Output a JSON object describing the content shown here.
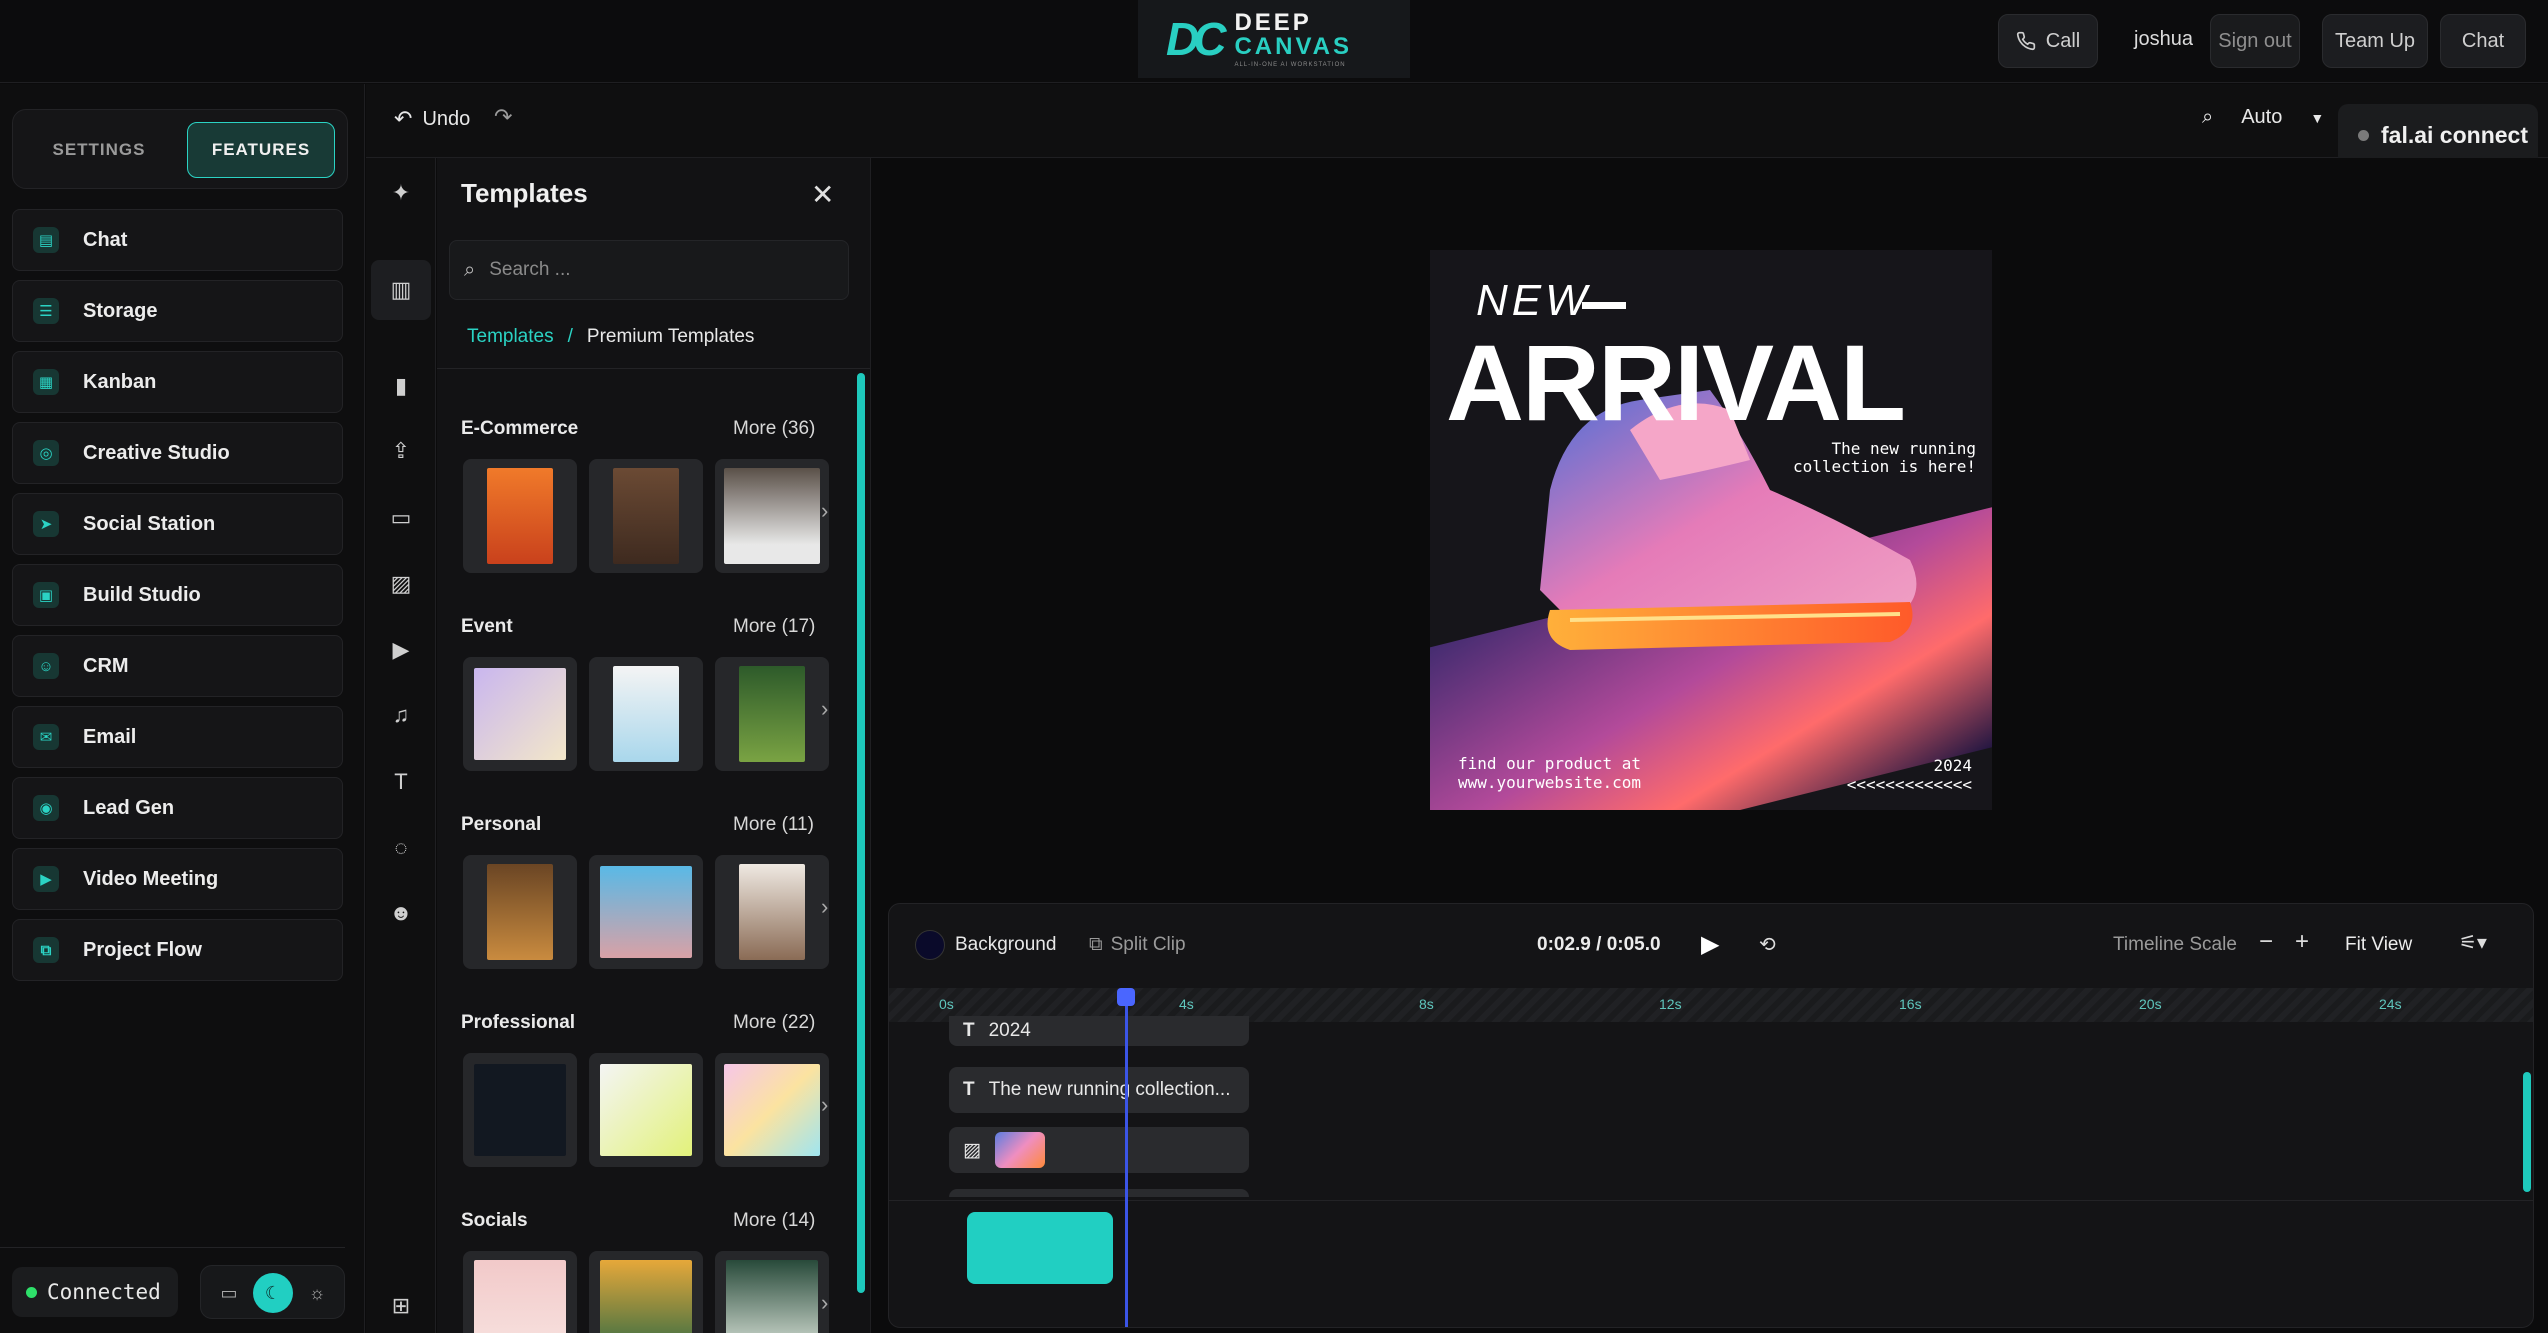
{
  "header": {
    "logo_mark": "DC",
    "logo_line1": "DEEP",
    "logo_line2": "CANVAS",
    "logo_tagline": "ALL-IN-ONE AI WORKSTATION",
    "call_label": "Call",
    "user_name": "joshua",
    "sign_out_label": "Sign out",
    "team_up_label": "Team Up",
    "chat_label": "Chat"
  },
  "sidebar": {
    "settings_tab": "SETTINGS",
    "features_tab": "FEATURES",
    "items": [
      {
        "label": "Chat",
        "icon": "chat-icon"
      },
      {
        "label": "Storage",
        "icon": "storage-icon"
      },
      {
        "label": "Kanban",
        "icon": "kanban-icon"
      },
      {
        "label": "Creative Studio",
        "icon": "palette-icon"
      },
      {
        "label": "Social Station",
        "icon": "send-icon"
      },
      {
        "label": "Build Studio",
        "icon": "grid-icon"
      },
      {
        "label": "CRM",
        "icon": "users-icon"
      },
      {
        "label": "Email",
        "icon": "mail-icon"
      },
      {
        "label": "Lead Gen",
        "icon": "target-icon"
      },
      {
        "label": "Video Meeting",
        "icon": "video-icon"
      },
      {
        "label": "Project Flow",
        "icon": "flow-icon"
      }
    ],
    "status": "Connected",
    "accent_color": "#2bd3c4"
  },
  "toolbar": {
    "undo_label": "Undo",
    "zoom_label": "Auto"
  },
  "fal": {
    "label": "fal.ai connect"
  },
  "templates": {
    "title": "Templates",
    "search_placeholder": "Search ...",
    "breadcrumb_root": "Templates",
    "breadcrumb_sep": "/",
    "breadcrumb_current": "Premium Templates",
    "sections": [
      {
        "title": "E-Commerce",
        "more": "More (36)"
      },
      {
        "title": "Event",
        "more": "More (17)"
      },
      {
        "title": "Personal",
        "more": "More (11)"
      },
      {
        "title": "Professional",
        "more": "More (22)"
      },
      {
        "title": "Socials",
        "more": "More (14)"
      }
    ]
  },
  "artwork": {
    "new": "NEW",
    "arrival": "ARRIVAL",
    "tagline": "The new running collection is here!",
    "find": "find our product at",
    "website": "www.yourwebsite.com",
    "year": "2024",
    "arrows": "<<<<<<<<<<<<<"
  },
  "timeline": {
    "background_label": "Background",
    "split_label": "Split Clip",
    "time": "0:02.9 / 0:05.0",
    "scale_label": "Timeline Scale",
    "fit_label": "Fit View",
    "ticks": [
      "0s",
      "4s",
      "8s",
      "12s",
      "16s",
      "20s",
      "24s"
    ],
    "tracks": [
      {
        "label": "2024",
        "icon": "text-icon"
      },
      {
        "label": "The new running collection...",
        "icon": "text-icon"
      },
      {
        "label": "",
        "icon": "image-icon"
      }
    ]
  }
}
